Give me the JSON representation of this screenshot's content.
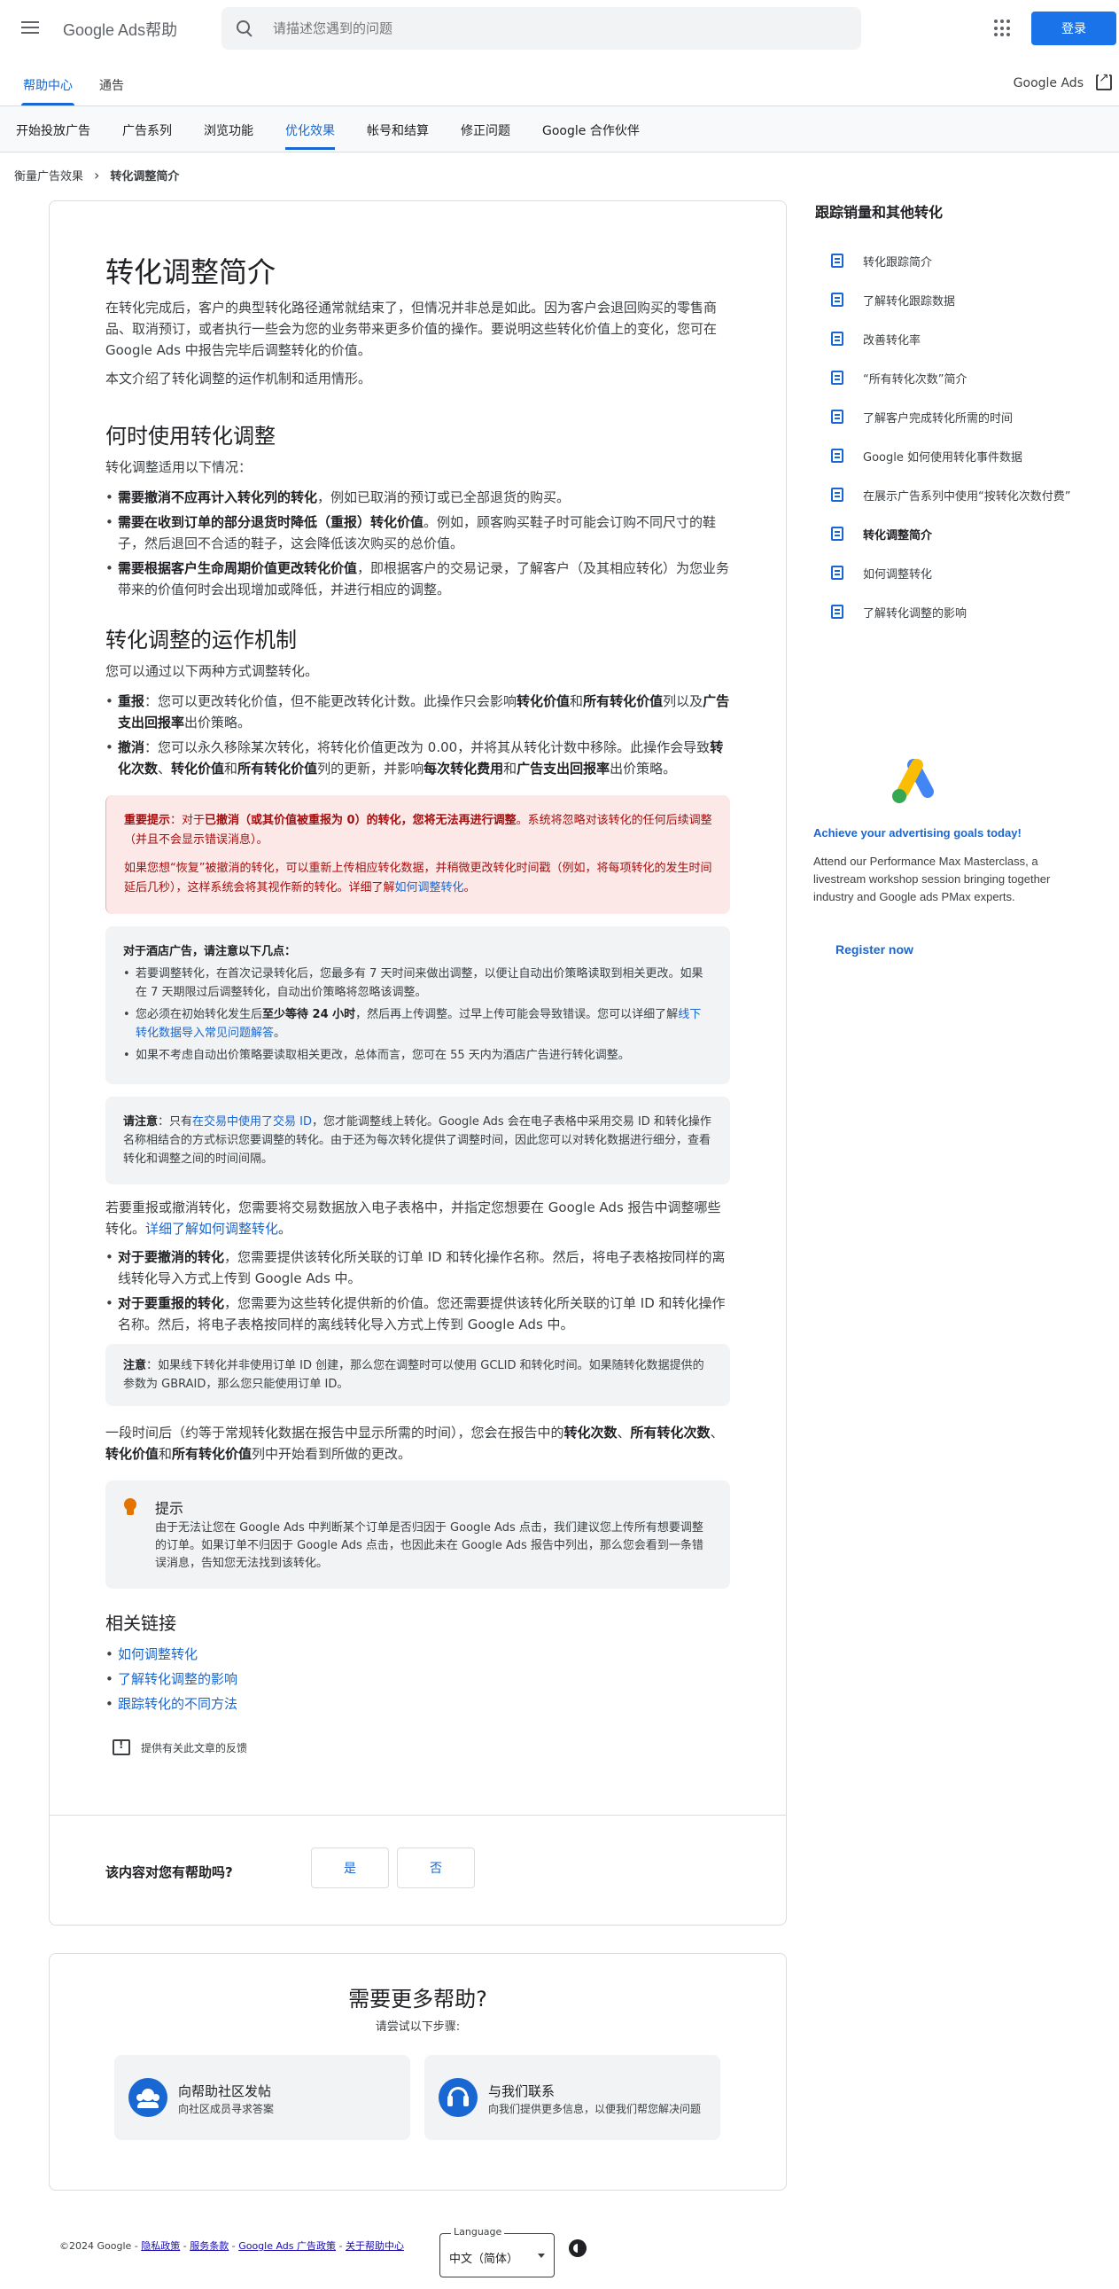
{
  "header": {
    "logo": "Google Ads帮助",
    "search_placeholder": "请描述您遇到的问题",
    "login": "登录"
  },
  "subnav": {
    "tabs": [
      "帮助中心",
      "通告"
    ],
    "product_link": "Google Ads"
  },
  "catnav": [
    "开始投放广告",
    "广告系列",
    "浏览功能",
    "优化效果",
    "帐号和结算",
    "修正问题",
    "Google 合作伙伴"
  ],
  "breadcrumb": [
    "衡量广告效果",
    "转化调整简介"
  ],
  "article": {
    "title": "转化调整简介",
    "intro1": "在转化完成后，客户的典型转化路径通常就结束了，但情况并非总是如此。因为客户会退回购买的零售商品、取消预订，或者执行一些会为您的业务带来更多价值的操作。要说明这些转化价值上的变化，您可在 Google Ads 中报告完毕后调整转化的价值。",
    "intro2": "本文介绍了转化调整的运作机制和适用情形。",
    "s1_title": "何时使用转化调整",
    "s1_lead": "转化调整适用以下情况：",
    "s1_items": [
      {
        "b": "需要撤消不应再计入转化列的转化",
        "t": "，例如已取消的预订或已全部退货的购买。"
      },
      {
        "b": "需要在收到订单的部分退货时降低（重报）转化价值",
        "t": "。例如，顾客购买鞋子时可能会订购不同尺寸的鞋子，然后退回不合适的鞋子，这会降低该次购买的总价值。"
      },
      {
        "b": "需要根据客户生命周期价值更改转化价值",
        "t": "，即根据客户的交易记录，了解客户（及其相应转化）为您业务带来的价值何时会出现增加或降低，并进行相应的调整。"
      }
    ],
    "s2_title": "转化调整的运作机制",
    "s2_lead": "您可以通过以下两种方式调整转化。",
    "s2_item1_b": "重报",
    "s2_item1_t": "：您可以更改转化价值，但不能更改转化计数。此操作只会影响",
    "s2_item1_b2": "转化价值",
    "s2_item1_t2": "和",
    "s2_item1_b3": "所有转化价值",
    "s2_item1_t3": "列以及",
    "s2_item1_b4": "广告支出回报率",
    "s2_item1_t4": "出价策略。",
    "s2_item2_b": "撤消",
    "s2_item2_t": "：您可以永久移除某次转化，将转化价值更改为 0.00，并将其从转化计数中移除。此操作会导致",
    "s2_item2_b2": "转化次数",
    "s2_item2_t2": "、",
    "s2_item2_b3": "转化价值",
    "s2_item2_t3": "和",
    "s2_item2_b4": "所有转化价值",
    "s2_item2_t4": "列的更新，并影响",
    "s2_item2_b5": "每次转化费用",
    "s2_item2_t5": "和",
    "s2_item2_b6": "广告支出回报率",
    "s2_item2_t6": "出价策略。",
    "red": {
      "p1_b1": "重要提示",
      "p1_t1": "：对于",
      "p1_b2": "已撤消（或其价值被重报为 0）的转化，您将无法再进行调整",
      "p1_t2": "。系统将忽略对该转化的任何后续调整（并且不会显示错误消息）。",
      "p2": "如果您想“恢复”被撤消的转化，可以重新上传相应转化数据，并稍微更改转化时间戳（例如，将每项转化的发生时间延后几秒），这样系统会将其视作新的转化。详细了解",
      "p2_link": "如何调整转化",
      "p2_end": "。"
    },
    "hotel": {
      "title": "对于酒店广告，请注意以下几点：",
      "i1": "若要调整转化，在首次记录转化后，您最多有 7 天时间来做出调整，以便让自动出价策略读取到相关更改。如果在 7 天期限过后调整转化，自动出价策略将忽略该调整。",
      "i2_a": "您必须在初始转化发生后",
      "i2_b": "至少等待 24 小时",
      "i2_c": "，然后再上传调整。过早上传可能会导致错误。您可以详细了解",
      "i2_link": "线下转化数据导入常见问题解答",
      "i2_d": "。",
      "i3": "如果不考虑自动出价策略要读取相关更改，总体而言，您可在 55 天内为酒店广告进行转化调整。"
    },
    "note1_b": "请注意",
    "note1_t": "：只有",
    "note1_link": "在交易中使用了交易 ID",
    "note1_t2": "，您才能调整线上转化。Google Ads 会在电子表格中采用交易 ID 和转化操作名称相结合的方式标识您要调整的转化。由于还为每次转化提供了调整时间，因此您可以对转化数据进行细分，查看转化和调整之间的时间间隔。",
    "p_upload": "若要重报或撤消转化，您需要将交易数据放入电子表格中，并指定您想要在 Google Ads 报告中调整哪些转化。",
    "p_upload_link": "详细了解如何调整转化",
    "p_upload_end": "。",
    "upload_items": [
      {
        "b": "对于要撤消的转化",
        "t": "，您需要提供该转化所关联的订单 ID 和转化操作名称。然后，将电子表格按同样的离线转化导入方式上传到 Google Ads 中。"
      },
      {
        "b": "对于要重报的转化",
        "t": "，您需要为这些转化提供新的价值。您还需要提供该转化所关联的订单 ID 和转化操作名称。然后，将电子表格按同样的离线转化导入方式上传到 Google Ads 中。"
      }
    ],
    "note2_b": "注意",
    "note2_t": "：如果线下转化并非使用订单 ID 创建，那么您在调整时可以使用 GCLID 和转化时间。如果随转化数据提供的参数为 GBRAID，那么您只能使用订单 ID。",
    "p_later_a": "一段时间后（约等于常规转化数据在报告中显示所需的时间），您会在报告中的",
    "p_later_b1": "转化次数",
    "p_later_t1": "、",
    "p_later_b2": "所有转化次数",
    "p_later_t2": "、",
    "p_later_b3": "转化价值",
    "p_later_t3": "和",
    "p_later_b4": "所有转化价值",
    "p_later_t4": "列中开始看到所做的更改。",
    "tip_title": "提示",
    "tip_body": "由于无法让您在 Google Ads 中判断某个订单是否归因于 Google Ads 点击，我们建议您上传所有想要调整的订单。如果订单不归因于 Google Ads 点击，也因此未在 Google Ads 报告中列出，那么您会看到一条错误消息，告知您无法找到该转化。",
    "related_title": "相关链接",
    "related": [
      "如何调整转化",
      "了解转化调整的影响",
      "跟踪转化的不同方法"
    ],
    "feedback": "提供有关此文章的反馈",
    "helpful_q": "该内容对您有帮助吗?",
    "yes": "是",
    "no": "否"
  },
  "sidebar": {
    "title": "跟踪销量和其他转化",
    "items": [
      "转化跟踪简介",
      "了解转化跟踪数据",
      "改善转化率",
      "“所有转化次数”简介",
      "了解客户完成转化所需的时间",
      "Google 如何使用转化事件数据",
      "在展示广告系列中使用“按转化次数付费”",
      "转化调整简介",
      "如何调整转化",
      "了解转化调整的影响"
    ],
    "active_index": 7
  },
  "promo": {
    "title": "Achieve your advertising goals today!",
    "body": "Attend our Performance Max Masterclass, a livestream workshop session bringing together industry and Google ads PMax experts.",
    "cta": "Register now"
  },
  "morehelp": {
    "title": "需要更多帮助?",
    "sub": "请尝试以下步骤:",
    "card1_title": "向帮助社区发帖",
    "card1_sub": "向社区成员寻求答案",
    "card2_title": "与我们联系",
    "card2_sub": "向我们提供更多信息，以便我们帮您解决问题"
  },
  "footer": {
    "copyright": "©2024 Google -",
    "links": [
      "隐私政策",
      "服务条款",
      "Google Ads 广告政策",
      "关于帮助中心"
    ],
    "lang_label": "Language",
    "lang_value": "中文（简体）"
  },
  "colors": {
    "accent": "#1a73e8",
    "link": "#1967d2",
    "warning_bg": "#fce8e6"
  }
}
